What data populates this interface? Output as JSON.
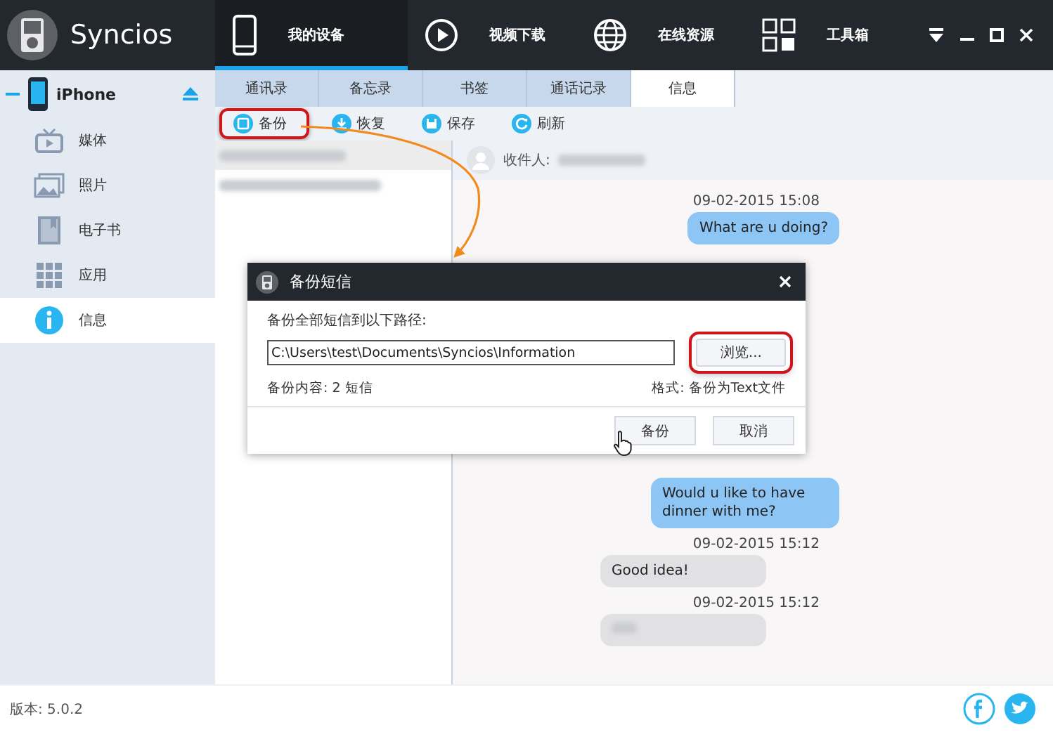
{
  "app": {
    "name": "Syncios"
  },
  "nav": [
    {
      "label": "我的设备",
      "selected": true
    },
    {
      "label": "视频下载",
      "selected": false
    },
    {
      "label": "在线资源",
      "selected": false
    },
    {
      "label": "工具箱",
      "selected": false
    }
  ],
  "sidebar": {
    "device": {
      "name": "iPhone",
      "expanded": true
    },
    "items": [
      {
        "label": "媒体",
        "selected": false
      },
      {
        "label": "照片",
        "selected": false
      },
      {
        "label": "电子书",
        "selected": false
      },
      {
        "label": "应用",
        "selected": false
      },
      {
        "label": "信息",
        "selected": true
      }
    ]
  },
  "subtabs": [
    {
      "label": "通讯录",
      "selected": false
    },
    {
      "label": "备忘录",
      "selected": false
    },
    {
      "label": "书签",
      "selected": false
    },
    {
      "label": "通话记录",
      "selected": false
    },
    {
      "label": "信息",
      "selected": true
    }
  ],
  "toolbar": [
    {
      "label": "备份",
      "highlighted": true
    },
    {
      "label": "恢复",
      "highlighted": false
    },
    {
      "label": "保存",
      "highlighted": false
    },
    {
      "label": "刷新",
      "highlighted": false
    }
  ],
  "contacts": [
    {
      "selected": true
    },
    {
      "selected": false
    }
  ],
  "conversation": {
    "recipient_label": "收件人:",
    "messages": [
      {
        "time": "09-02-2015 15:08",
        "text": "What are u doing?",
        "kind": "sent"
      },
      {
        "text": "Would u like to have dinner with me?",
        "kind": "sent"
      },
      {
        "time": "09-02-2015 15:12",
        "text": "Good idea!",
        "kind": "received"
      },
      {
        "time": "09-02-2015 15:12",
        "kind": "received",
        "redacted": true
      }
    ]
  },
  "dialog": {
    "title": "备份短信",
    "prompt": "备份全部短信到以下路径:",
    "path": "C:\\Users\\test\\Documents\\Syncios\\Information",
    "browse": {
      "label": "浏览...",
      "highlighted": true
    },
    "content": "备份内容: 2 短信",
    "format": "格式: 备份为Text文件",
    "buttons": [
      {
        "label": "备份",
        "hovered": true
      },
      {
        "label": "取消",
        "hovered": false
      }
    ]
  },
  "footer": {
    "version": "版本: 5.0.2"
  }
}
